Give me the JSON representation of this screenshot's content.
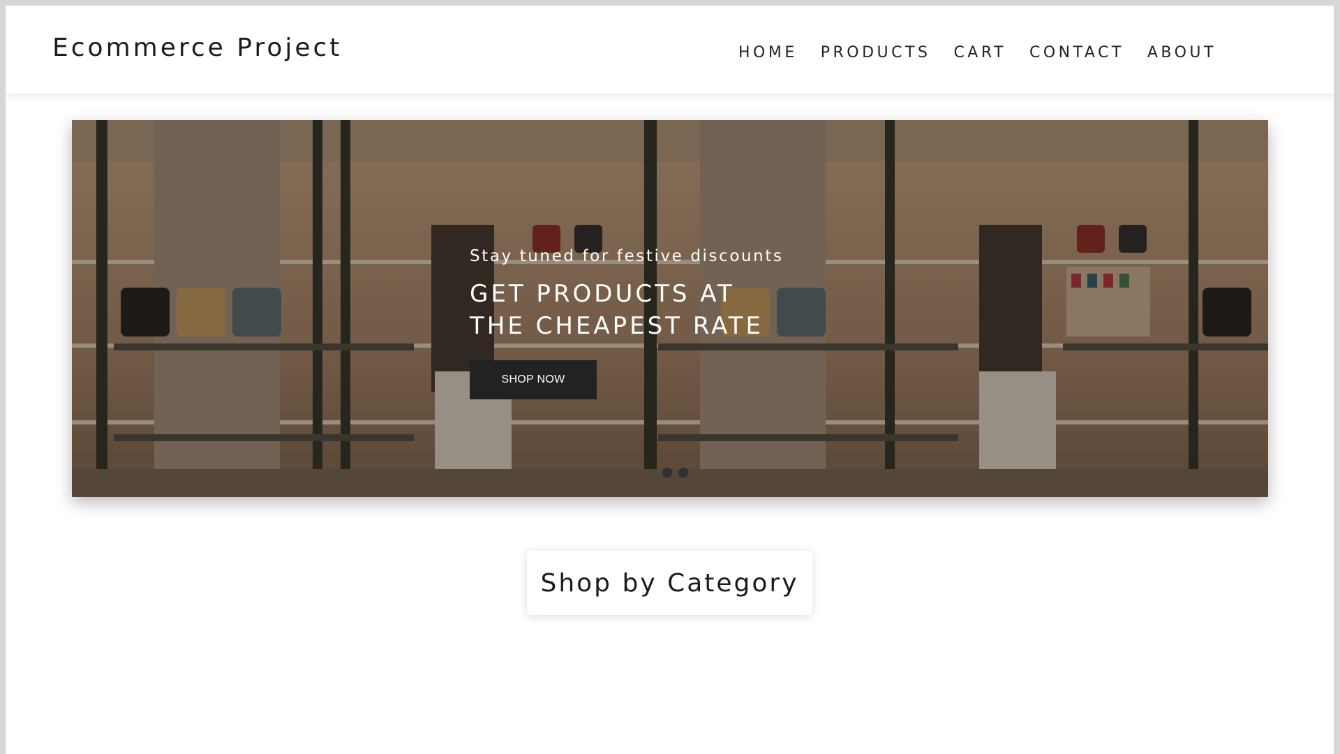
{
  "header": {
    "brand": "Ecommerce Project",
    "nav": [
      "HOME",
      "PRODUCTS",
      "CART",
      "CONTACT",
      "ABOUT"
    ]
  },
  "hero": {
    "subtitle": "Stay tuned for festive discounts",
    "title": "GET PRODUCTS AT THE CHEAPEST RATE",
    "button_label": "SHOP NOW",
    "slides_count": 2,
    "active_slide": 1
  },
  "category_section": {
    "title": "Shop by Category"
  },
  "colors": {
    "button_bg": "#222222",
    "page_bg": "#ffffff",
    "hero_tint": "#6e5a45"
  }
}
